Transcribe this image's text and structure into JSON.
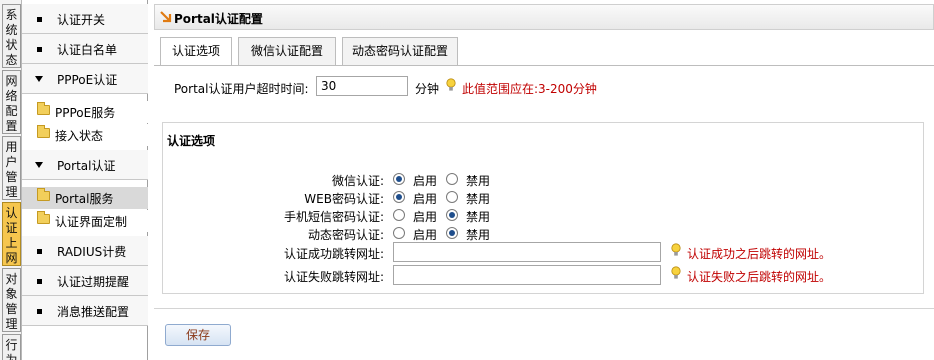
{
  "vtabs": [
    {
      "label": "系统状态"
    },
    {
      "label": "网络配置"
    },
    {
      "label": "用户管理"
    },
    {
      "label": "认证上网"
    },
    {
      "label": "对象管理"
    },
    {
      "label": "行为"
    }
  ],
  "sidebar": {
    "items": [
      {
        "label": "认证开关"
      },
      {
        "label": "认证白名单"
      },
      {
        "label": "PPPoE认证"
      },
      {
        "label": "PPPoE服务"
      },
      {
        "label": "接入状态"
      },
      {
        "label": "Portal认证"
      },
      {
        "label": "Portal服务"
      },
      {
        "label": "认证界面定制"
      },
      {
        "label": "RADIUS计费"
      },
      {
        "label": "认证过期提醒"
      },
      {
        "label": "消息推送配置"
      }
    ]
  },
  "page": {
    "title": "Portal认证配置",
    "tabs": [
      {
        "label": "认证选项"
      },
      {
        "label": "微信认证配置"
      },
      {
        "label": "动态密码认证配置"
      }
    ]
  },
  "timeout": {
    "label": "Portal认证用户超时时间:",
    "value": "30",
    "unit": "分钟",
    "hint": "此值范围应在:3-200分钟"
  },
  "options": {
    "group_title": "认证选项",
    "enable_label": "启用",
    "disable_label": "禁用",
    "rows": [
      {
        "label": "微信认证:",
        "state": "enabled"
      },
      {
        "label": "WEB密码认证:",
        "state": "enabled"
      },
      {
        "label": "手机短信密码认证:",
        "state": "disabled"
      },
      {
        "label": "动态密码认证:",
        "state": "disabled"
      }
    ],
    "success_url": {
      "label": "认证成功跳转网址:",
      "value": "",
      "hint": "认证成功之后跳转的网址。"
    },
    "fail_url": {
      "label": "认证失败跳转网址:",
      "value": "",
      "hint": "认证失败之后跳转的网址。"
    }
  },
  "actions": {
    "save_label": "保存"
  },
  "colors": {
    "active_vtab": "#f6c64e",
    "hint_text": "#c00000",
    "radio_dot": "#1f4e8c"
  },
  "icons": {
    "hint": "lightbulb-icon",
    "title": "arrow-icon",
    "folder": "folder-icon"
  }
}
